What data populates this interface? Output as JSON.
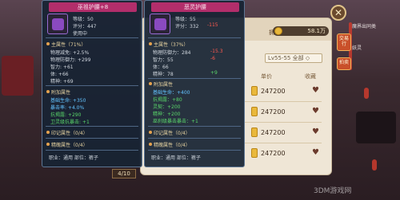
{
  "market": {
    "held_label": "拥有",
    "held_value": "58.1万",
    "filter_text": "Lv55-55 全部 ◇",
    "col_price": "单价",
    "col_fav": "收藏",
    "rows": [
      {
        "price": "247200"
      },
      {
        "price": "247200"
      },
      {
        "price": "247200"
      },
      {
        "price": "247200"
      }
    ],
    "page": "4/10"
  },
  "side": {
    "close": "✕",
    "trade": "交易行",
    "auction": "拍卖"
  },
  "right_strip": [
    "魔界出同类",
    "妖灵"
  ],
  "tip_left": {
    "title": "巫祖护腰+8",
    "level": "等级：50",
    "score": "评分：447",
    "status": "使用中",
    "main_attr": "主属性（71%）",
    "lines": [
      {
        "text": "物理减免: +2.5%",
        "color": "gray"
      },
      {
        "text": "物理防御力: +299",
        "color": "gray"
      },
      {
        "text": "智力: +61",
        "color": "gray"
      },
      {
        "text": "体: +66",
        "color": "gray"
      },
      {
        "text": "精神: +69",
        "color": "gray"
      }
    ],
    "extra_attr": "附加属性",
    "extra_lines": [
      {
        "text": "基础生命: +350",
        "color": "cyan"
      },
      {
        "text": "暴击率: +4.0%",
        "color": "cyan"
      },
      {
        "text": "抗揭露: +290",
        "color": "green"
      },
      {
        "text": "卫灵级抗暴击: +1",
        "color": "green"
      }
    ],
    "mark": "印记属性（0/4）",
    "spirit": "精魄属性（0/4）",
    "job": "职业：通用  部位：裤子"
  },
  "tip_right": {
    "title": "恶灵护腰",
    "level": "等级：55",
    "score": "评分：332",
    "score_delta": "-115",
    "main_attr": "主属性（37%）",
    "lines": [
      {
        "text": "物理防御力：284",
        "delta": "-15.3",
        "color": "gray"
      },
      {
        "text": "智力：55",
        "delta": "-6",
        "color": "gray"
      },
      {
        "text": "体：66",
        "delta": "",
        "color": "gray"
      },
      {
        "text": "精神：78",
        "delta": "+9",
        "color": "gray"
      }
    ],
    "extra_attr": "附加属性",
    "extra_lines": [
      {
        "text": "基础生命：+400",
        "color": "cyan"
      },
      {
        "text": "抗揭露：+80",
        "color": "green"
      },
      {
        "text": "灵契：+200",
        "color": "green"
      },
      {
        "text": "精神：+200",
        "color": "green"
      },
      {
        "text": "巫刹级暴击暴击：+1",
        "color": "green"
      }
    ],
    "mark": "印记属性（0/4）",
    "spirit": "精魄属性（0/4）",
    "job": "职业：通用  部位：裤子"
  },
  "watermark": "3DM游戏网"
}
